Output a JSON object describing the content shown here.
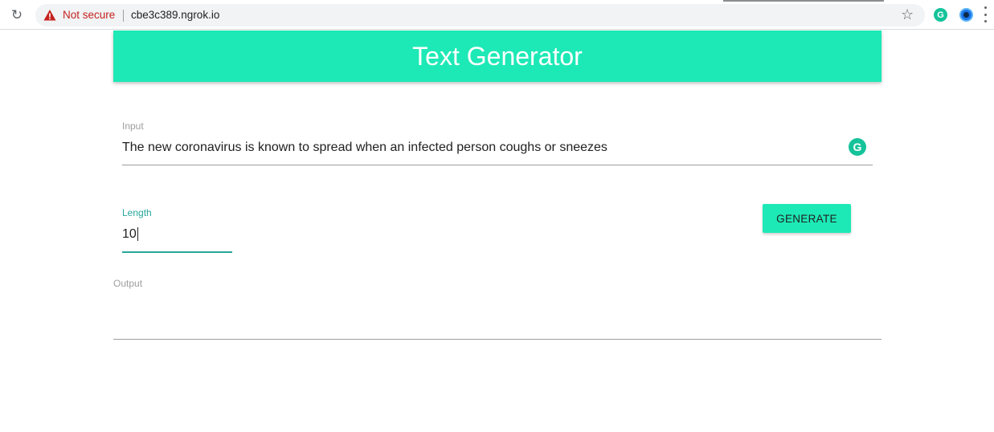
{
  "browser": {
    "security_label": "Not secure",
    "url": "cbe3c389.ngrok.io",
    "icons": {
      "reload": "reload-icon",
      "warning": "warning-icon",
      "bookmark": "star-icon",
      "extension_1": "grammarly-extension-icon",
      "extension_2": "extension-icon",
      "menu": "more-vert-icon"
    },
    "colors": {
      "warning": "#c5221f"
    }
  },
  "app": {
    "title": "Text Generator",
    "accent_color": "#1de9b6",
    "focus_color": "#26a69a"
  },
  "form": {
    "input": {
      "label": "Input",
      "value": "The new coronavirus is known to spread when an infected person coughs or sneezes"
    },
    "length": {
      "label": "Length",
      "value": "10"
    },
    "generate_label": "GENERATE",
    "output": {
      "label": "Output",
      "value": ""
    }
  }
}
